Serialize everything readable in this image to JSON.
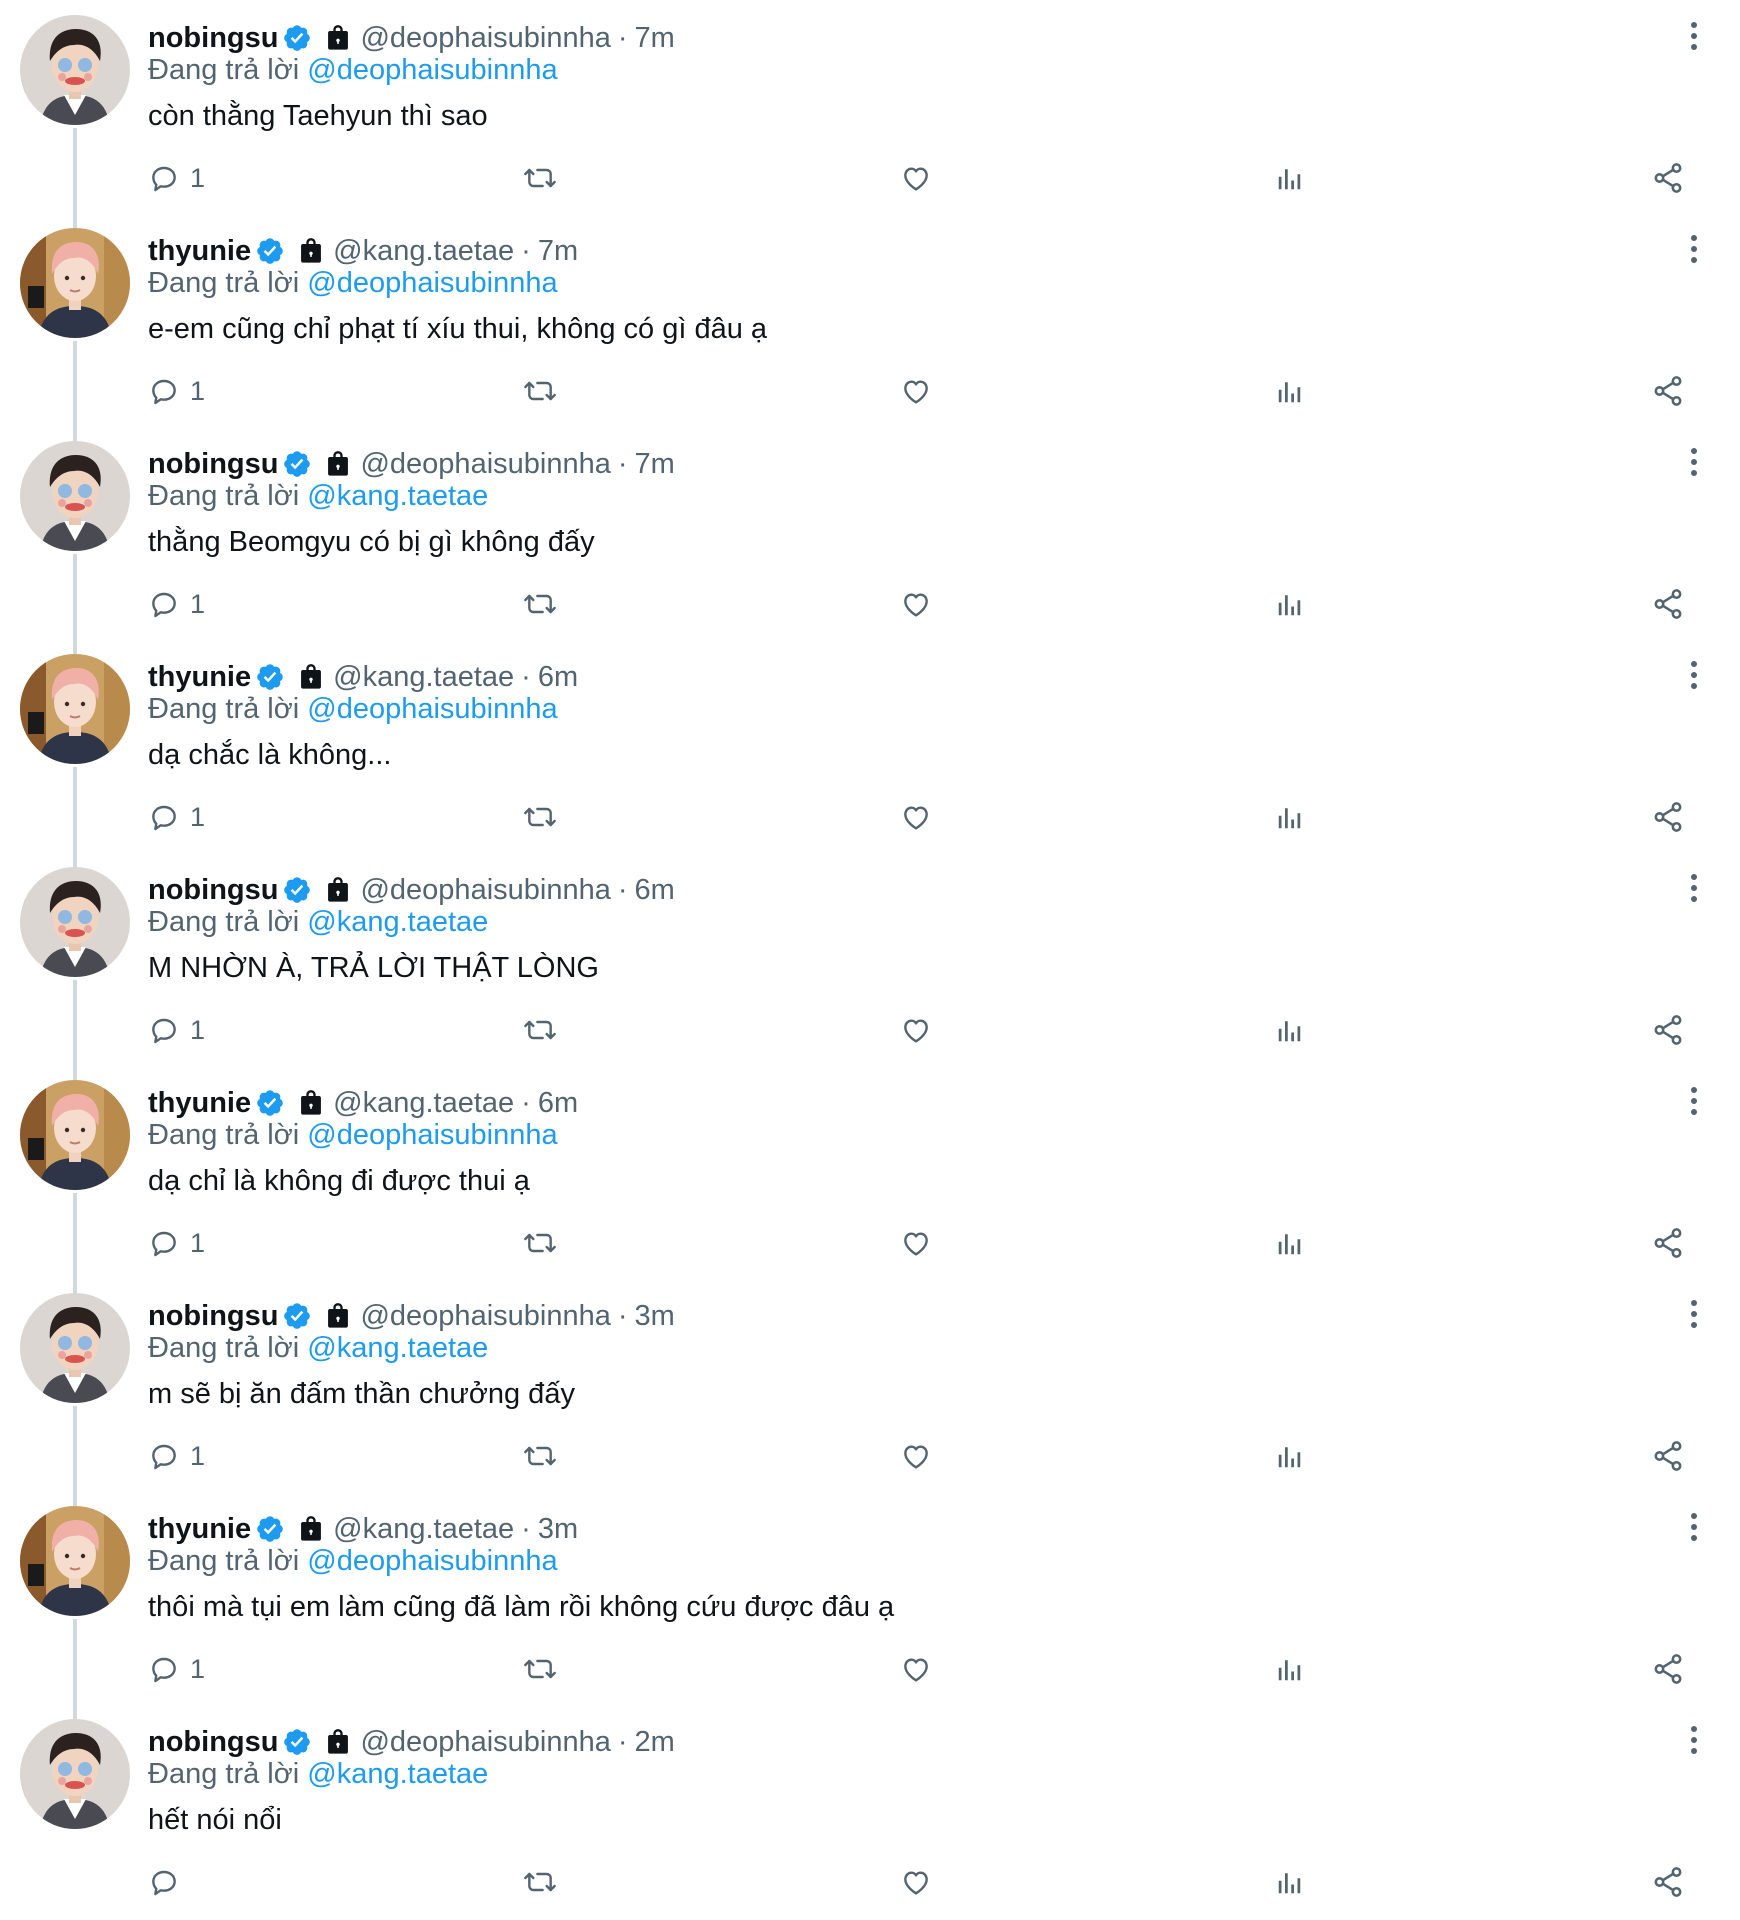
{
  "users": {
    "nobingsu": {
      "display_name": "nobingsu",
      "handle": "@deophaisubinnha",
      "avatar_icon": "avatar-nobingsu-icon"
    },
    "thyunie": {
      "display_name": "thyunie",
      "handle": "@kang.taetae",
      "avatar_icon": "avatar-thyunie-icon"
    }
  },
  "replying_label": "Đang trả lời",
  "colors": {
    "accent": "#1d9bf0",
    "secondary_text": "#536471",
    "thread_line": "#cfd9de",
    "verified": "#1d9bf0"
  },
  "icons": [
    "verified-badge-icon",
    "lock-icon",
    "more-icon",
    "reply-icon",
    "retweet-icon",
    "like-icon",
    "views-icon",
    "share-icon"
  ],
  "tweets": [
    {
      "author": "nobingsu",
      "name": "nobingsu",
      "handle": "@deophaisubinnha",
      "time": "7m",
      "reply_to": "@deophaisubinnha",
      "text": "còn thằng Taehyun thì sao",
      "reply_count": "1"
    },
    {
      "author": "thyunie",
      "name": "thyunie",
      "handle": "@kang.taetae",
      "time": "7m",
      "reply_to": "@deophaisubinnha",
      "text": "e-em cũng chỉ phạt tí xíu thui, không có gì đâu ạ",
      "reply_count": "1"
    },
    {
      "author": "nobingsu",
      "name": "nobingsu",
      "handle": "@deophaisubinnha",
      "time": "7m",
      "reply_to": "@kang.taetae",
      "text": "thằng Beomgyu có bị gì không đấy",
      "reply_count": "1"
    },
    {
      "author": "thyunie",
      "name": "thyunie",
      "handle": "@kang.taetae",
      "time": "6m",
      "reply_to": "@deophaisubinnha",
      "text": "dạ chắc là không...",
      "reply_count": "1"
    },
    {
      "author": "nobingsu",
      "name": "nobingsu",
      "handle": "@deophaisubinnha",
      "time": "6m",
      "reply_to": "@kang.taetae",
      "text": "M NHỜN À, TRẢ LỜI THẬT LÒNG",
      "reply_count": "1"
    },
    {
      "author": "thyunie",
      "name": "thyunie",
      "handle": "@kang.taetae",
      "time": "6m",
      "reply_to": "@deophaisubinnha",
      "text": "dạ chỉ là không đi được thui ạ",
      "reply_count": "1"
    },
    {
      "author": "nobingsu",
      "name": "nobingsu",
      "handle": "@deophaisubinnha",
      "time": "3m",
      "reply_to": "@kang.taetae",
      "text": "m sẽ bị ăn đấm thần chưởng đấy",
      "reply_count": "1"
    },
    {
      "author": "thyunie",
      "name": "thyunie",
      "handle": "@kang.taetae",
      "time": "3m",
      "reply_to": "@deophaisubinnha",
      "text": "thôi mà tụi em làm cũng đã làm rồi không cứu được đâu ạ",
      "reply_count": "1"
    },
    {
      "author": "nobingsu",
      "name": "nobingsu",
      "handle": "@deophaisubinnha",
      "time": "2m",
      "reply_to": "@kang.taetae",
      "text": "hết nói nổi",
      "reply_count": ""
    }
  ]
}
